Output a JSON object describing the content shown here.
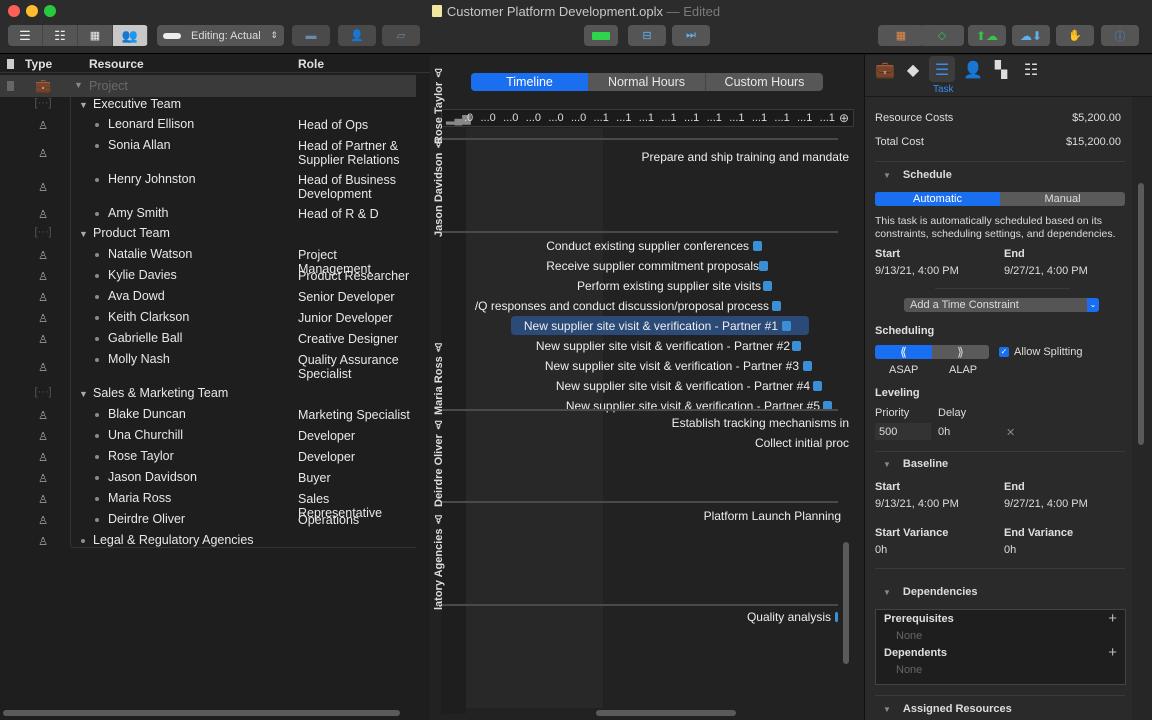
{
  "window": {
    "title": "Customer Platform Development.oplx",
    "status": "— Edited"
  },
  "toolbar": {
    "view_modes": [
      "outline-view",
      "gantt-view",
      "network-view",
      "resource-view"
    ],
    "active_view": 3,
    "editing_select": "Editing: Actual",
    "right_buttons": [
      "table-icon",
      "milestone-icon",
      "publish-icon",
      "update-icon",
      "stop-icon",
      "info-icon"
    ]
  },
  "outline": {
    "headers": {
      "type": "Type",
      "resource": "Resource",
      "role": "Role"
    },
    "project_row": "Project",
    "rows": [
      {
        "kind": "group",
        "name": "Executive Team",
        "role": ""
      },
      {
        "kind": "person",
        "name": "Leonard Ellison",
        "role": "Head of Ops"
      },
      {
        "kind": "person",
        "name": "Sonia Allan",
        "role": "Head of Partner & Supplier Relations"
      },
      {
        "kind": "person",
        "name": "Henry Johnston",
        "role": "Head of Business Development"
      },
      {
        "kind": "person",
        "name": "Amy Smith",
        "role": "Head of R & D"
      },
      {
        "kind": "group",
        "name": "Product Team",
        "role": ""
      },
      {
        "kind": "person",
        "name": "Natalie Watson",
        "role": "Project Management"
      },
      {
        "kind": "person",
        "name": "Kylie Davies",
        "role": "Product Researcher"
      },
      {
        "kind": "person",
        "name": "Ava Dowd",
        "role": "Senior Developer"
      },
      {
        "kind": "person",
        "name": "Keith Clarkson",
        "role": "Junior Developer"
      },
      {
        "kind": "person",
        "name": "Gabrielle Ball",
        "role": "Creative Designer"
      },
      {
        "kind": "person",
        "name": "Molly Nash",
        "role": "Quality Assurance Specialist"
      },
      {
        "kind": "group",
        "name": "Sales & Marketing Team",
        "role": ""
      },
      {
        "kind": "person",
        "name": "Blake Duncan",
        "role": "Marketing Specialist"
      },
      {
        "kind": "person",
        "name": "Una Churchill",
        "role": "Developer"
      },
      {
        "kind": "person",
        "name": "Rose Taylor",
        "role": "Developer"
      },
      {
        "kind": "person",
        "name": "Jason Davidson",
        "role": "Buyer"
      },
      {
        "kind": "person",
        "name": "Maria Ross",
        "role": "Sales Representative"
      },
      {
        "kind": "person",
        "name": "Deirdre Oliver",
        "role": "Operations"
      },
      {
        "kind": "toplevel-person",
        "name": "Legal & Regulatory Agencies",
        "role": ""
      }
    ]
  },
  "timeline": {
    "tabs": [
      "Timeline",
      "Normal Hours",
      "Custom Hours"
    ],
    "active_tab": 0,
    "ruler_ticks": [
      ".0",
      "...0",
      "...0",
      "...0",
      "...0",
      "...0",
      "...1",
      "...1",
      "...1",
      "...1",
      "...1",
      "...1",
      "...1",
      "...1",
      "...1",
      "...1",
      "...1"
    ],
    "lanes": [
      {
        "resource": "Rose Taylor",
        "tasks": [
          "Prepare and ship training and mandate"
        ]
      },
      {
        "resource": "Jason Davidson",
        "tasks": [
          "Conduct existing supplier conferences",
          "Receive supplier commitment proposals",
          "Perform existing supplier site visits",
          "/Q responses and conduct discussion/proposal process",
          "New supplier site visit & verification - Partner #1",
          "New supplier site visit & verification - Partner #2",
          "New supplier site visit & verification - Partner #3",
          "New supplier site visit & verification - Partner #4",
          "New supplier site visit & verification - Partner #5"
        ],
        "selected": 4
      },
      {
        "resource": "Maria Ross",
        "tasks": [
          "Establish tracking mechanisms in",
          "Collect initial proc"
        ]
      },
      {
        "resource": "Deirdre Oliver",
        "tasks": [
          "Platform Launch Planning"
        ]
      },
      {
        "resource": "latory Agencies",
        "tasks": [
          "Quality analysis"
        ]
      }
    ]
  },
  "inspector": {
    "tabs": [
      "project-icon",
      "milestone-icon",
      "task-icon",
      "resource-icon",
      "style-icon",
      "table-icon"
    ],
    "active_tab_label": "Task",
    "resource_costs_label": "Resource Costs",
    "resource_costs": "$5,200.00",
    "total_cost_label": "Total Cost",
    "total_cost": "$15,200.00",
    "schedule": {
      "title": "Schedule",
      "modes": [
        "Automatic",
        "Manual"
      ],
      "active_mode": 0,
      "description": "This task is automatically scheduled based on its constraints, scheduling settings, and dependencies.",
      "start_label": "Start",
      "start": "9/13/21, 4:00 PM",
      "end_label": "End",
      "end": "9/27/21, 4:00 PM",
      "constraint_select": "Add a Time Constraint",
      "scheduling_label": "Scheduling",
      "asap": "ASAP",
      "alap": "ALAP",
      "allow_splitting": "Allow Splitting",
      "allow_splitting_checked": true,
      "leveling_label": "Leveling",
      "priority_label": "Priority",
      "priority": "500",
      "delay_label": "Delay",
      "delay": "0h"
    },
    "baseline": {
      "title": "Baseline",
      "start_label": "Start",
      "start": "9/13/21, 4:00 PM",
      "end_label": "End",
      "end": "9/27/21, 4:00 PM",
      "start_var_label": "Start Variance",
      "start_var": "0h",
      "end_var_label": "End Variance",
      "end_var": "0h"
    },
    "dependencies": {
      "title": "Dependencies",
      "prereq_label": "Prerequisites",
      "prereq_value": "None",
      "dependents_label": "Dependents",
      "dependents_value": "None"
    },
    "assigned_resources_title": "Assigned Resources"
  }
}
